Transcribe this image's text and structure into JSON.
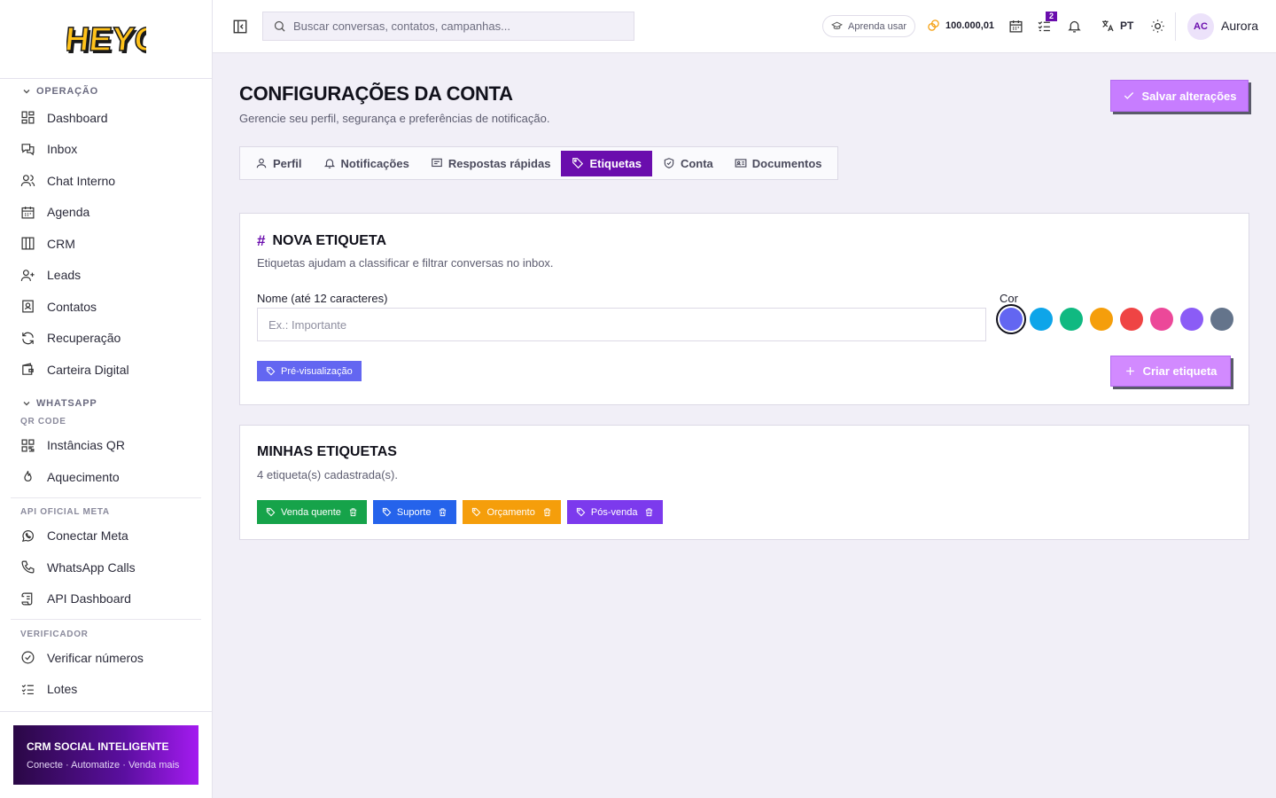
{
  "brand": {
    "logo_text": "HEYOO"
  },
  "sidebar": {
    "sections": [
      {
        "title": "OPERAÇÃO",
        "items": [
          "Dashboard",
          "Inbox",
          "Chat Interno",
          "Agenda",
          "CRM",
          "Leads",
          "Contatos",
          "Recuperação",
          "Carteira Digital"
        ]
      },
      {
        "title": "WHATSAPP",
        "subsections": [
          {
            "title": "QR CODE",
            "items": [
              "Instâncias QR",
              "Aquecimento"
            ]
          },
          {
            "title": "API OFICIAL META",
            "items": [
              "Conectar Meta",
              "WhatsApp Calls",
              "API Dashboard"
            ]
          },
          {
            "title": "VERIFICADOR",
            "items": [
              "Verificar números",
              "Lotes"
            ]
          }
        ]
      }
    ],
    "promo": {
      "title": "CRM SOCIAL INTELIGENTE",
      "subtitle": "Conecte · Automatize · Venda mais"
    }
  },
  "topbar": {
    "search_placeholder": "Buscar conversas, contatos, campanhas...",
    "learn_label": "Aprenda usar",
    "credits": "100.000,01",
    "tasks_badge": "2",
    "language": "PT",
    "user_initials": "AC",
    "user_name": "Aurora"
  },
  "page": {
    "title": "CONFIGURAÇÕES DA CONTA",
    "subtitle": "Gerencie seu perfil, segurança e preferências de notificação.",
    "save_label": "Salvar alterações",
    "tabs": [
      {
        "label": "Perfil",
        "icon": "user-icon"
      },
      {
        "label": "Notificações",
        "icon": "bell-icon"
      },
      {
        "label": "Respostas rápidas",
        "icon": "message-square-icon"
      },
      {
        "label": "Etiquetas",
        "icon": "tag-icon",
        "active": true
      },
      {
        "label": "Conta",
        "icon": "shield-icon"
      },
      {
        "label": "Documentos",
        "icon": "id-card-icon"
      }
    ]
  },
  "new_tag": {
    "title": "NOVA ETIQUETA",
    "subtitle": "Etiquetas ajudam a classificar e filtrar conversas no inbox.",
    "name_label": "Nome (até 12 caracteres)",
    "name_placeholder": "Ex.: Importante",
    "color_label": "Cor",
    "colors": [
      "#6366f1",
      "#0ea5e9",
      "#10b981",
      "#f59e0b",
      "#ef4444",
      "#ec4899",
      "#8b5cf6",
      "#64748b"
    ],
    "selected_color": "#6366f1",
    "preview_label": "Pré-visualização",
    "create_label": "Criar etiqueta"
  },
  "my_tags": {
    "title": "MINHAS ETIQUETAS",
    "count_text": "4 etiqueta(s) cadastrada(s).",
    "tags": [
      {
        "label": "Venda quente",
        "color": "#16a34a"
      },
      {
        "label": "Suporte",
        "color": "#2563eb"
      },
      {
        "label": "Orçamento",
        "color": "#f59e0b"
      },
      {
        "label": "Pós-venda",
        "color": "#7c3aed"
      }
    ]
  }
}
